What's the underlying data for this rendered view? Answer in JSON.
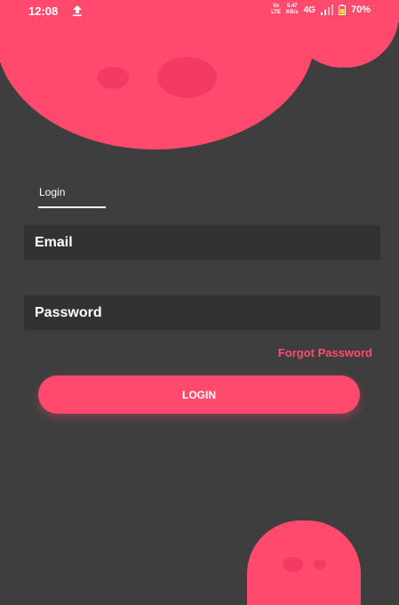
{
  "status_bar": {
    "time": "12:08",
    "volte_top": "Vo",
    "volte_bottom": "LTE",
    "speed_value": "5.47",
    "speed_unit": "KB/s",
    "network": "4G",
    "battery": "70%"
  },
  "tabs": {
    "login_label": "Login"
  },
  "form": {
    "email_placeholder": "Email",
    "password_placeholder": "Password",
    "forgot_label": "Forgot Password",
    "login_button_label": "LOGIN"
  },
  "colors": {
    "accent": "#ff4a6e",
    "background": "#3e3e3e",
    "field": "#323232"
  },
  "icons": [
    "upload-icon",
    "signal-icon",
    "battery-icon"
  ]
}
